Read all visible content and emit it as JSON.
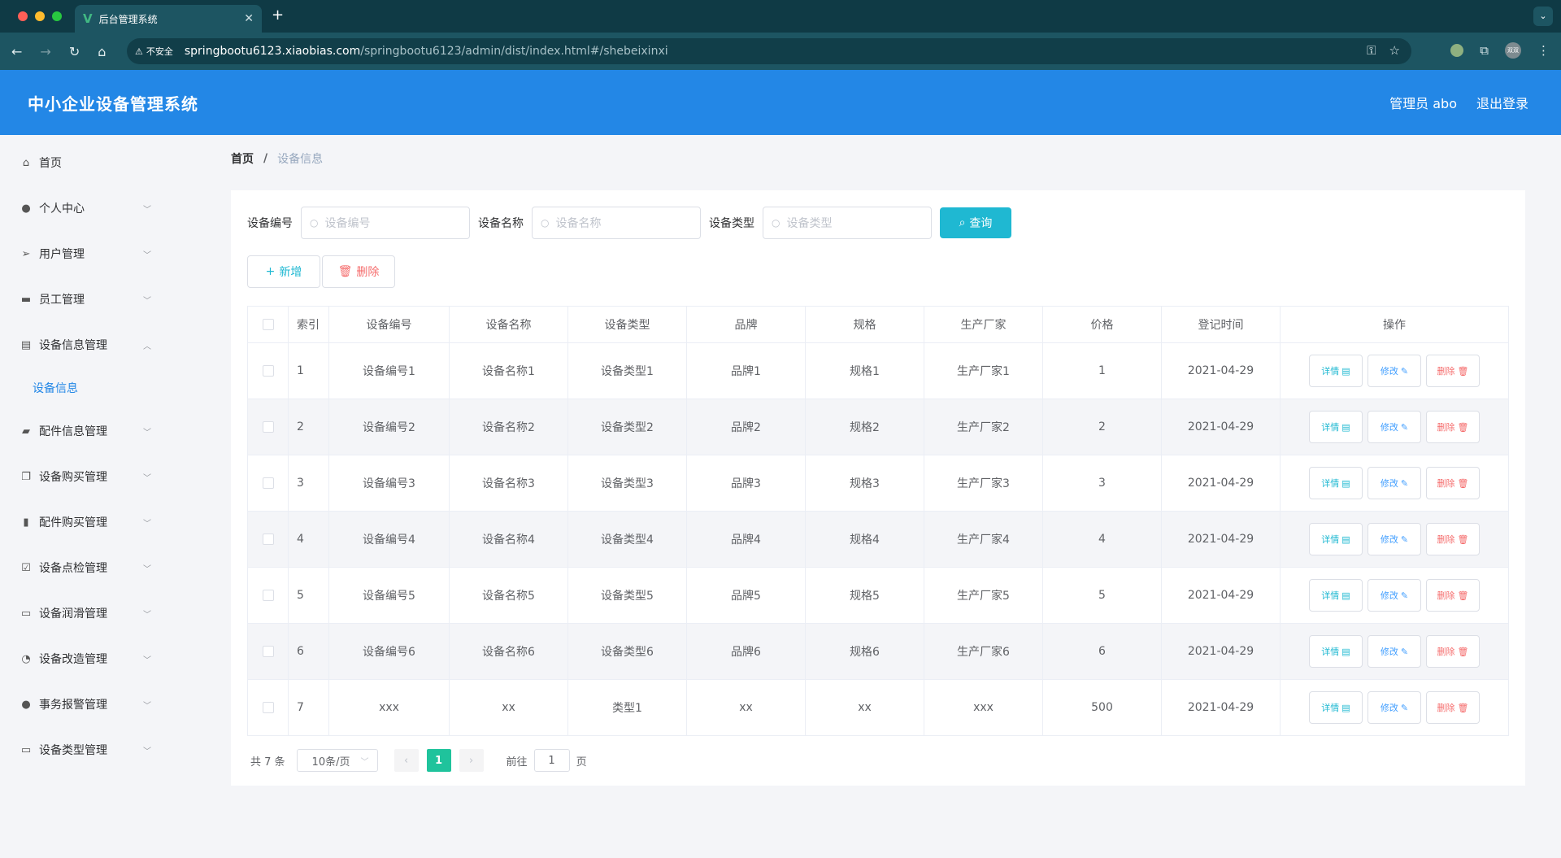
{
  "browser": {
    "tab_title": "后台管理系统",
    "insecure_label": "不安全",
    "url_host": "springbootu6123.xiaobias.com",
    "url_path": "/springbootu6123/admin/dist/index.html#/shebeixinxi",
    "profile_label": "双双"
  },
  "header": {
    "title": "中小企业设备管理系统",
    "user_label": "管理员 abo",
    "logout_label": "退出登录"
  },
  "sidebar": {
    "items": [
      {
        "label": "首页"
      },
      {
        "label": "个人中心"
      },
      {
        "label": "用户管理"
      },
      {
        "label": "员工管理"
      },
      {
        "label": "设备信息管理"
      },
      {
        "label": "配件信息管理"
      },
      {
        "label": "设备购买管理"
      },
      {
        "label": "配件购买管理"
      },
      {
        "label": "设备点检管理"
      },
      {
        "label": "设备润滑管理"
      },
      {
        "label": "设备改造管理"
      },
      {
        "label": "事务报警管理"
      },
      {
        "label": "设备类型管理"
      }
    ],
    "active_sub": "设备信息"
  },
  "breadcrumb": {
    "home": "首页",
    "sep": "/",
    "current": "设备信息"
  },
  "search": {
    "f1_label": "设备编号",
    "f1_placeholder": "设备编号",
    "f2_label": "设备名称",
    "f2_placeholder": "设备名称",
    "f3_label": "设备类型",
    "f3_placeholder": "设备类型",
    "query_label": "查询"
  },
  "actions": {
    "add_label": "新增",
    "delete_label": "删除"
  },
  "table": {
    "headers": [
      "索引",
      "设备编号",
      "设备名称",
      "设备类型",
      "品牌",
      "规格",
      "生产厂家",
      "价格",
      "登记时间",
      "操作"
    ],
    "rows": [
      [
        "1",
        "设备编号1",
        "设备名称1",
        "设备类型1",
        "品牌1",
        "规格1",
        "生产厂家1",
        "1",
        "2021-04-29"
      ],
      [
        "2",
        "设备编号2",
        "设备名称2",
        "设备类型2",
        "品牌2",
        "规格2",
        "生产厂家2",
        "2",
        "2021-04-29"
      ],
      [
        "3",
        "设备编号3",
        "设备名称3",
        "设备类型3",
        "品牌3",
        "规格3",
        "生产厂家3",
        "3",
        "2021-04-29"
      ],
      [
        "4",
        "设备编号4",
        "设备名称4",
        "设备类型4",
        "品牌4",
        "规格4",
        "生产厂家4",
        "4",
        "2021-04-29"
      ],
      [
        "5",
        "设备编号5",
        "设备名称5",
        "设备类型5",
        "品牌5",
        "规格5",
        "生产厂家5",
        "5",
        "2021-04-29"
      ],
      [
        "6",
        "设备编号6",
        "设备名称6",
        "设备类型6",
        "品牌6",
        "规格6",
        "生产厂家6",
        "6",
        "2021-04-29"
      ],
      [
        "7",
        "xxx",
        "xx",
        "类型1",
        "xx",
        "xx",
        "xxx",
        "500",
        "2021-04-29"
      ]
    ],
    "op_detail": "详情",
    "op_edit": "修改",
    "op_delete": "删除"
  },
  "pager": {
    "total": "共 7 条",
    "page_size": "10条/页",
    "current_page": "1",
    "goto_prefix": "前往",
    "goto_value": "1",
    "goto_suffix": "页"
  },
  "colors": {
    "header_bg": "#2387e6",
    "accent_cyan": "#1fb8d2",
    "page_active": "#1fc39c",
    "danger": "#f56c6c"
  }
}
